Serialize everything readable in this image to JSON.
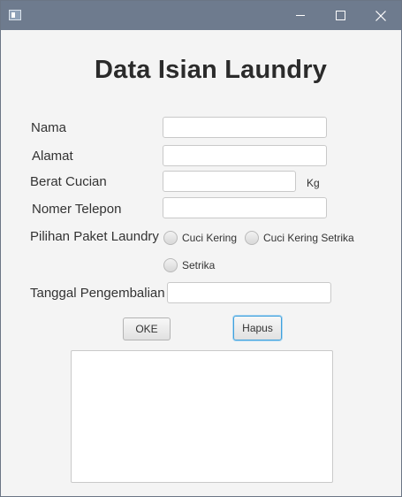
{
  "window": {
    "icon": "app-window-icon",
    "controls": [
      "minimize-icon",
      "maximize-icon",
      "close-icon"
    ]
  },
  "heading": "Data Isian Laundry",
  "form": {
    "nama_label": "Nama",
    "alamat_label": "Alamat",
    "berat_label": "Berat Cucian",
    "berat_unit": "Kg",
    "telepon_label": "Nomer Telepon",
    "paket_label": "Pilihan Paket Laundry",
    "paket_options": [
      "Cuci Kering",
      "Cuci Kering Setrika",
      "Setrika"
    ],
    "tanggal_label": "Tanggal Pengembalian"
  },
  "buttons": {
    "ok": "OKE",
    "hapus": "Hapus"
  }
}
